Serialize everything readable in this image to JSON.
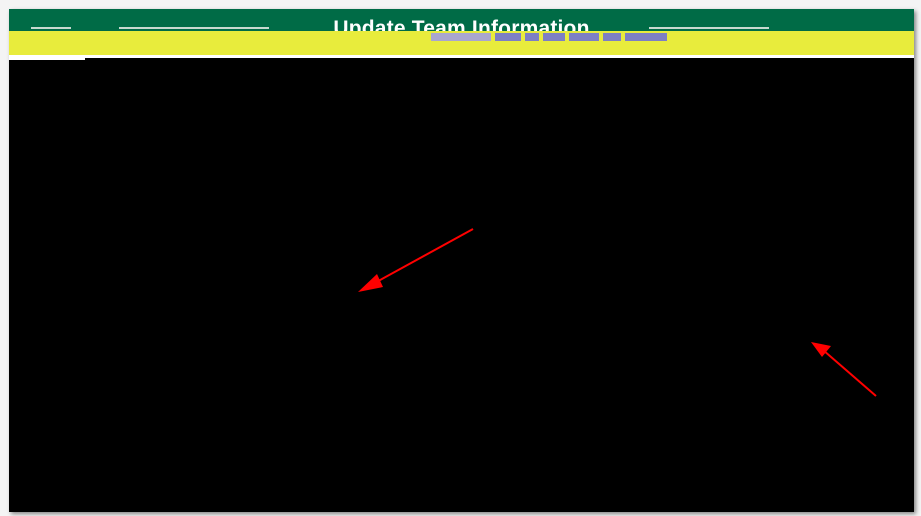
{
  "header": {
    "title": "Update Team Information"
  },
  "colors": {
    "header_bg": "#006b46",
    "subbar_bg": "#e8ec3c",
    "content_bg": "#000000",
    "annotation_arrow": "#ff0000",
    "nav_segment": "#7d7fc4"
  },
  "annotations": {
    "arrows": [
      {
        "name": "annotation-arrow-left",
        "icon": "arrow-icon"
      },
      {
        "name": "annotation-arrow-right",
        "icon": "arrow-icon"
      }
    ]
  }
}
